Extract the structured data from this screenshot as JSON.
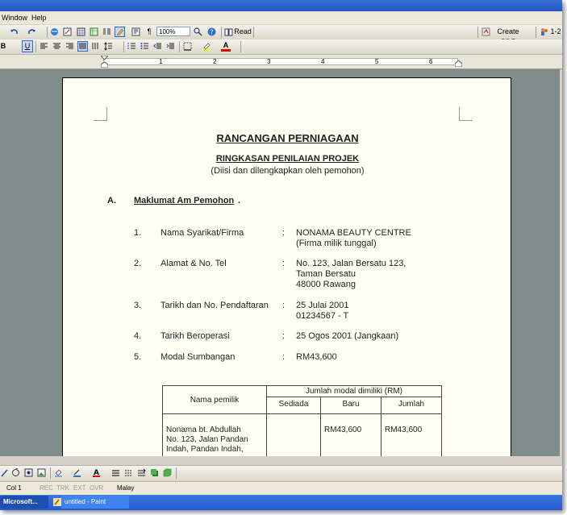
{
  "menu": {
    "window": "Window",
    "help": "Help"
  },
  "toolbar": {
    "zoom": "100%",
    "paragraph_mark": "¶",
    "read_label": "Read",
    "create_pdf_label": "Create PDF",
    "right_label": "1-2"
  },
  "formatting": {
    "bold": "B",
    "underline": "U",
    "font_color_glyph": "A"
  },
  "ruler": {
    "numbers": [
      "1",
      "2",
      "3",
      "4",
      "5",
      "6"
    ]
  },
  "document": {
    "title": "RANCANGAN PERNIAGAAN",
    "subtitle": "RINGKASAN PENILAIAN PROJEK",
    "note": "(Diisi dan dilengkapkan oleh pemohon)",
    "section": {
      "letter": "A.",
      "heading": "Maklumat Am Pemohon",
      "trailing": "."
    },
    "items": [
      {
        "num": "1.",
        "label": "Nama Syarikat/Firma",
        "sep": ":",
        "lines": [
          "NONAMA BEAUTY CENTRE",
          "(Firma milik tunggal)"
        ]
      },
      {
        "num": "2.",
        "label": "Alamat & No. Tel",
        "sep": ":",
        "lines": [
          "No. 123, Jalan Bersatu 123,",
          "Taman Bersatu",
          "48000 Rawang"
        ]
      },
      {
        "num": "3.",
        "label": "Tarikh dan No. Pendaftaran",
        "sep": ":",
        "lines": [
          "25 Julai 2001",
          "01234567 - T"
        ]
      },
      {
        "num": "4.",
        "label": "Tarikh Beroperasi",
        "sep": ":",
        "lines": [
          "25 Ogos 2001 (Jangkaan)"
        ]
      },
      {
        "num": "5.",
        "label": "Modal Sumbangan",
        "sep": ":",
        "lines": [
          "RM43,600"
        ]
      }
    ],
    "table": {
      "owner_header": "Nama  pemilik",
      "capital_header": "Jumlah modal dimiliki (RM)",
      "sub_headers": [
        "Sediada",
        "Baru",
        "Jumlah"
      ],
      "row": {
        "owner_lines": [
          "Nonama bt. Abdullah",
          "No.  123,  Jalan  Pandan",
          "Indah, Pandan Indah,"
        ],
        "sediada": "",
        "baru": "RM43,600",
        "jumlah": "RM43,600"
      }
    }
  },
  "status": {
    "col": "Col 1",
    "rec": "REC",
    "trk": "TRK",
    "ext": "EXT",
    "ovr": "OVR",
    "lang": "Malay"
  },
  "taskbar": {
    "items": [
      "Microsoft...",
      "untitled - Paint"
    ]
  }
}
